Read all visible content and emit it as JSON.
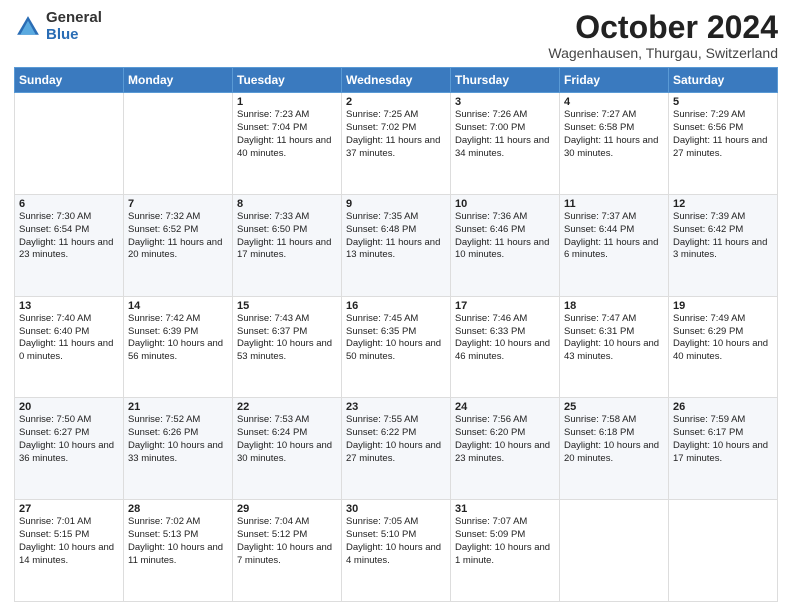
{
  "header": {
    "logo_general": "General",
    "logo_blue": "Blue",
    "month": "October 2024",
    "location": "Wagenhausen, Thurgau, Switzerland"
  },
  "weekdays": [
    "Sunday",
    "Monday",
    "Tuesday",
    "Wednesday",
    "Thursday",
    "Friday",
    "Saturday"
  ],
  "weeks": [
    [
      {
        "day": "",
        "info": ""
      },
      {
        "day": "",
        "info": ""
      },
      {
        "day": "1",
        "info": "Sunrise: 7:23 AM\nSunset: 7:04 PM\nDaylight: 11 hours and 40 minutes."
      },
      {
        "day": "2",
        "info": "Sunrise: 7:25 AM\nSunset: 7:02 PM\nDaylight: 11 hours and 37 minutes."
      },
      {
        "day": "3",
        "info": "Sunrise: 7:26 AM\nSunset: 7:00 PM\nDaylight: 11 hours and 34 minutes."
      },
      {
        "day": "4",
        "info": "Sunrise: 7:27 AM\nSunset: 6:58 PM\nDaylight: 11 hours and 30 minutes."
      },
      {
        "day": "5",
        "info": "Sunrise: 7:29 AM\nSunset: 6:56 PM\nDaylight: 11 hours and 27 minutes."
      }
    ],
    [
      {
        "day": "6",
        "info": "Sunrise: 7:30 AM\nSunset: 6:54 PM\nDaylight: 11 hours and 23 minutes."
      },
      {
        "day": "7",
        "info": "Sunrise: 7:32 AM\nSunset: 6:52 PM\nDaylight: 11 hours and 20 minutes."
      },
      {
        "day": "8",
        "info": "Sunrise: 7:33 AM\nSunset: 6:50 PM\nDaylight: 11 hours and 17 minutes."
      },
      {
        "day": "9",
        "info": "Sunrise: 7:35 AM\nSunset: 6:48 PM\nDaylight: 11 hours and 13 minutes."
      },
      {
        "day": "10",
        "info": "Sunrise: 7:36 AM\nSunset: 6:46 PM\nDaylight: 11 hours and 10 minutes."
      },
      {
        "day": "11",
        "info": "Sunrise: 7:37 AM\nSunset: 6:44 PM\nDaylight: 11 hours and 6 minutes."
      },
      {
        "day": "12",
        "info": "Sunrise: 7:39 AM\nSunset: 6:42 PM\nDaylight: 11 hours and 3 minutes."
      }
    ],
    [
      {
        "day": "13",
        "info": "Sunrise: 7:40 AM\nSunset: 6:40 PM\nDaylight: 11 hours and 0 minutes."
      },
      {
        "day": "14",
        "info": "Sunrise: 7:42 AM\nSunset: 6:39 PM\nDaylight: 10 hours and 56 minutes."
      },
      {
        "day": "15",
        "info": "Sunrise: 7:43 AM\nSunset: 6:37 PM\nDaylight: 10 hours and 53 minutes."
      },
      {
        "day": "16",
        "info": "Sunrise: 7:45 AM\nSunset: 6:35 PM\nDaylight: 10 hours and 50 minutes."
      },
      {
        "day": "17",
        "info": "Sunrise: 7:46 AM\nSunset: 6:33 PM\nDaylight: 10 hours and 46 minutes."
      },
      {
        "day": "18",
        "info": "Sunrise: 7:47 AM\nSunset: 6:31 PM\nDaylight: 10 hours and 43 minutes."
      },
      {
        "day": "19",
        "info": "Sunrise: 7:49 AM\nSunset: 6:29 PM\nDaylight: 10 hours and 40 minutes."
      }
    ],
    [
      {
        "day": "20",
        "info": "Sunrise: 7:50 AM\nSunset: 6:27 PM\nDaylight: 10 hours and 36 minutes."
      },
      {
        "day": "21",
        "info": "Sunrise: 7:52 AM\nSunset: 6:26 PM\nDaylight: 10 hours and 33 minutes."
      },
      {
        "day": "22",
        "info": "Sunrise: 7:53 AM\nSunset: 6:24 PM\nDaylight: 10 hours and 30 minutes."
      },
      {
        "day": "23",
        "info": "Sunrise: 7:55 AM\nSunset: 6:22 PM\nDaylight: 10 hours and 27 minutes."
      },
      {
        "day": "24",
        "info": "Sunrise: 7:56 AM\nSunset: 6:20 PM\nDaylight: 10 hours and 23 minutes."
      },
      {
        "day": "25",
        "info": "Sunrise: 7:58 AM\nSunset: 6:18 PM\nDaylight: 10 hours and 20 minutes."
      },
      {
        "day": "26",
        "info": "Sunrise: 7:59 AM\nSunset: 6:17 PM\nDaylight: 10 hours and 17 minutes."
      }
    ],
    [
      {
        "day": "27",
        "info": "Sunrise: 7:01 AM\nSunset: 5:15 PM\nDaylight: 10 hours and 14 minutes."
      },
      {
        "day": "28",
        "info": "Sunrise: 7:02 AM\nSunset: 5:13 PM\nDaylight: 10 hours and 11 minutes."
      },
      {
        "day": "29",
        "info": "Sunrise: 7:04 AM\nSunset: 5:12 PM\nDaylight: 10 hours and 7 minutes."
      },
      {
        "day": "30",
        "info": "Sunrise: 7:05 AM\nSunset: 5:10 PM\nDaylight: 10 hours and 4 minutes."
      },
      {
        "day": "31",
        "info": "Sunrise: 7:07 AM\nSunset: 5:09 PM\nDaylight: 10 hours and 1 minute."
      },
      {
        "day": "",
        "info": ""
      },
      {
        "day": "",
        "info": ""
      }
    ]
  ]
}
